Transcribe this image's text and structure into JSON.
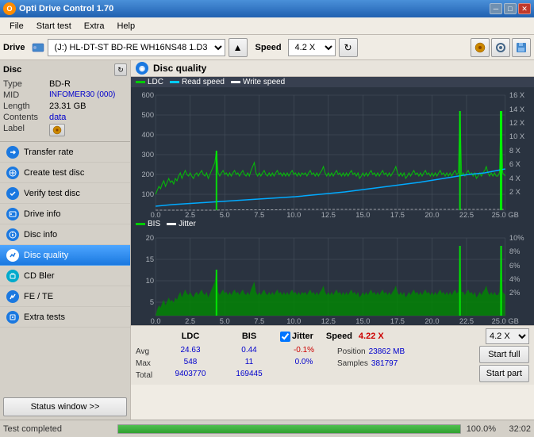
{
  "titleBar": {
    "title": "Opti Drive Control 1.70",
    "minBtn": "─",
    "maxBtn": "□",
    "closeBtn": "✕"
  },
  "menuBar": {
    "items": [
      "File",
      "Start test",
      "Extra",
      "Help"
    ]
  },
  "toolbar": {
    "driveLabel": "Drive",
    "driveValue": "(J:)  HL-DT-ST BD-RE  WH16NS48 1.D3",
    "speedLabel": "Speed",
    "speedValue": "4.2 X"
  },
  "disc": {
    "title": "Disc",
    "typeLabel": "Type",
    "typeValue": "BD-R",
    "midLabel": "MID",
    "midValue": "INFOMER30 (000)",
    "lengthLabel": "Length",
    "lengthValue": "23.31 GB",
    "contentsLabel": "Contents",
    "contentsValue": "data",
    "labelLabel": "Label",
    "labelValue": ""
  },
  "navItems": [
    {
      "id": "transfer-rate",
      "label": "Transfer rate",
      "active": false
    },
    {
      "id": "create-test-disc",
      "label": "Create test disc",
      "active": false
    },
    {
      "id": "verify-test-disc",
      "label": "Verify test disc",
      "active": false
    },
    {
      "id": "drive-info",
      "label": "Drive info",
      "active": false
    },
    {
      "id": "disc-info",
      "label": "Disc info",
      "active": false
    },
    {
      "id": "disc-quality",
      "label": "Disc quality",
      "active": true
    },
    {
      "id": "cd-bler",
      "label": "CD Bler",
      "active": false
    },
    {
      "id": "fe-te",
      "label": "FE / TE",
      "active": false
    },
    {
      "id": "extra-tests",
      "label": "Extra tests",
      "active": false
    }
  ],
  "statusWindowBtn": "Status window >>",
  "chartHeader": {
    "title": "Disc quality"
  },
  "legend1": {
    "items": [
      {
        "label": "LDC",
        "color": "#00cc00"
      },
      {
        "label": "Read speed",
        "color": "#00ccff"
      },
      {
        "label": "Write speed",
        "color": "#ffffff"
      }
    ]
  },
  "legend2": {
    "items": [
      {
        "label": "BIS",
        "color": "#00cc00"
      },
      {
        "label": "Jitter",
        "color": "#ffffff"
      }
    ]
  },
  "topChart": {
    "yMax": 600,
    "yLabels": [
      "600",
      "500",
      "400",
      "300",
      "200",
      "100"
    ],
    "yRight": [
      "16 X",
      "14 X",
      "12 X",
      "10 X",
      "8 X",
      "6 X",
      "4 X",
      "2 X"
    ],
    "xLabels": [
      "0.0",
      "2.5",
      "5.0",
      "7.5",
      "10.0",
      "12.5",
      "15.0",
      "17.5",
      "20.0",
      "22.5",
      "25.0 GB"
    ]
  },
  "bottomChart": {
    "yMax": 20,
    "yLabels": [
      "20",
      "15",
      "10",
      "5"
    ],
    "yRight": [
      "10%",
      "8%",
      "6%",
      "4%",
      "2%"
    ],
    "xLabels": [
      "0.0",
      "2.5",
      "5.0",
      "7.5",
      "10.0",
      "12.5",
      "15.0",
      "17.5",
      "20.0",
      "22.5",
      "25.0 GB"
    ]
  },
  "stats": {
    "jitterChecked": true,
    "columns": [
      {
        "header": "LDC",
        "avg": "24.63",
        "max": "548",
        "total": "9403770"
      },
      {
        "header": "BIS",
        "avg": "0.44",
        "max": "11",
        "total": "169445"
      },
      {
        "header": "Jitter",
        "avg": "-0.1%",
        "max": "0.0%",
        "total": ""
      }
    ],
    "speed": {
      "label": "Speed",
      "avgValue": "4.22 X",
      "posLabel": "Position",
      "posValue": "23862 MB",
      "samplesLabel": "Samples",
      "samplesValue": "381797"
    },
    "speedSelect": "4.2 X",
    "startFullBtn": "Start full",
    "startPartBtn": "Start part",
    "labels": {
      "avg": "Avg",
      "max": "Max",
      "total": "Total"
    }
  },
  "statusBar": {
    "text": "Test completed",
    "percent": "100.0%",
    "time": "32:02"
  }
}
